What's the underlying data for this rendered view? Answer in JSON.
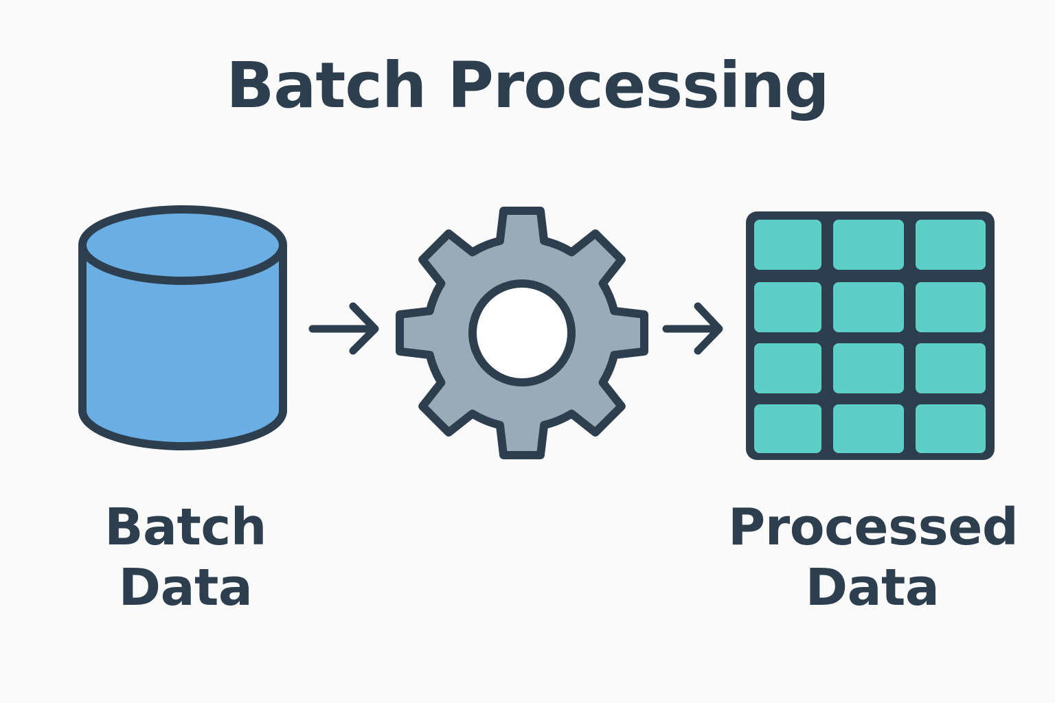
{
  "title": "Batch Processing",
  "nodes": [
    {
      "id": "source",
      "label_lines": [
        "Batch",
        "Data"
      ],
      "icon": "database-cylinder-icon",
      "fill": "#6aaee3"
    },
    {
      "id": "process",
      "label_lines": [],
      "icon": "gear-icon",
      "fill": "#9aabb8"
    },
    {
      "id": "output",
      "label_lines": [
        "Processed",
        "Data"
      ],
      "icon": "table-grid-icon",
      "fill": "#5ecfc6"
    }
  ],
  "edges": [
    {
      "from": "source",
      "to": "process"
    },
    {
      "from": "process",
      "to": "output"
    }
  ],
  "colors": {
    "outline": "#2d3e4f",
    "background": "#fafafa",
    "database": "#6aaee3",
    "gear": "#9aabb8",
    "table": "#5ecfc6"
  }
}
